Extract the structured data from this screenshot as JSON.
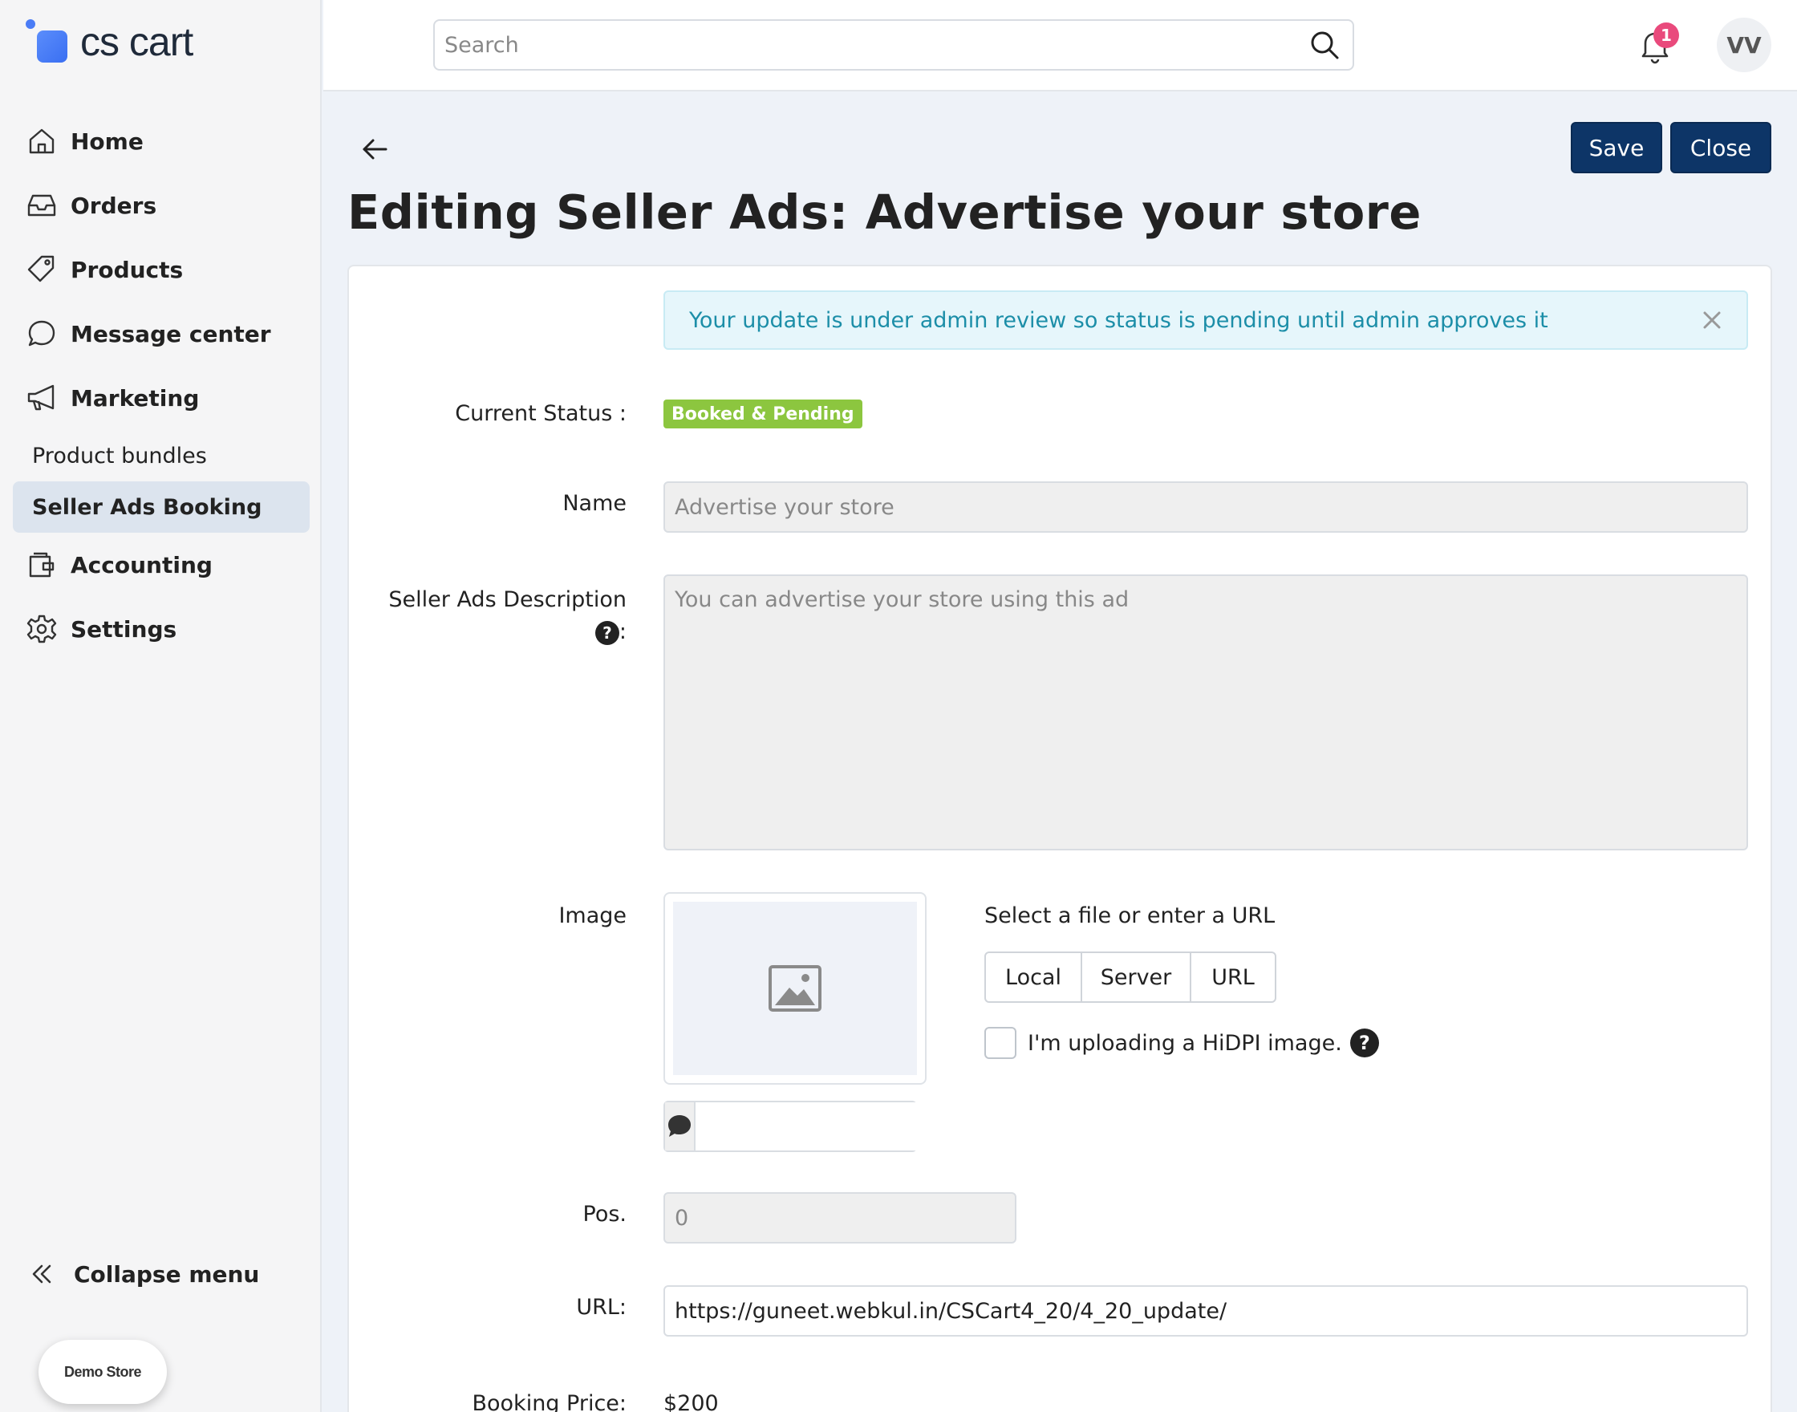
{
  "brand": {
    "name": "cs cart"
  },
  "sidebar": {
    "items": [
      {
        "label": "Home",
        "icon": "home-icon"
      },
      {
        "label": "Orders",
        "icon": "inbox-icon"
      },
      {
        "label": "Products",
        "icon": "tag-icon"
      },
      {
        "label": "Message center",
        "icon": "chat-icon"
      },
      {
        "label": "Marketing",
        "icon": "megaphone-icon"
      }
    ],
    "sub_items": [
      {
        "label": "Product bundles",
        "active": false
      },
      {
        "label": "Seller Ads Booking",
        "active": true
      }
    ],
    "items_after": [
      {
        "label": "Accounting",
        "icon": "wallet-icon"
      },
      {
        "label": "Settings",
        "icon": "gear-icon"
      }
    ],
    "collapse_label": "Collapse menu",
    "demo_store_label": "Demo Store"
  },
  "topbar": {
    "search_placeholder": "Search",
    "notification_count": "1",
    "avatar_initials": "VV"
  },
  "page": {
    "title": "Editing Seller Ads: Advertise your store",
    "save_label": "Save",
    "close_label": "Close"
  },
  "form": {
    "alert_text": "Your update is under admin review so status is pending until admin approves it",
    "status_label": "Current Status :",
    "status_value": "Booked & Pending",
    "status_color": "#8cc63f",
    "name_label": "Name",
    "name_value": "Advertise your store",
    "description_label": "Seller Ads Description",
    "description_colon": ":",
    "description_value": "You can advertise your store using this ad",
    "image_label": "Image",
    "select_file_label": "Select a file or enter a URL",
    "file_sources": [
      "Local",
      "Server",
      "URL"
    ],
    "hidpi_label": "I'm uploading a HiDPI image.",
    "pos_label": "Pos.",
    "pos_value": "0",
    "url_label": "URL:",
    "url_value": "https://guneet.webkul.in/CSCart4_20/4_20_update/",
    "booking_price_label": "Booking Price:",
    "booking_price_value": "$200"
  },
  "colors": {
    "primary": "#0d3567",
    "alert_text": "#1c8ea8",
    "alert_bg": "#e6f6fb",
    "badge": "#e94a7c"
  }
}
